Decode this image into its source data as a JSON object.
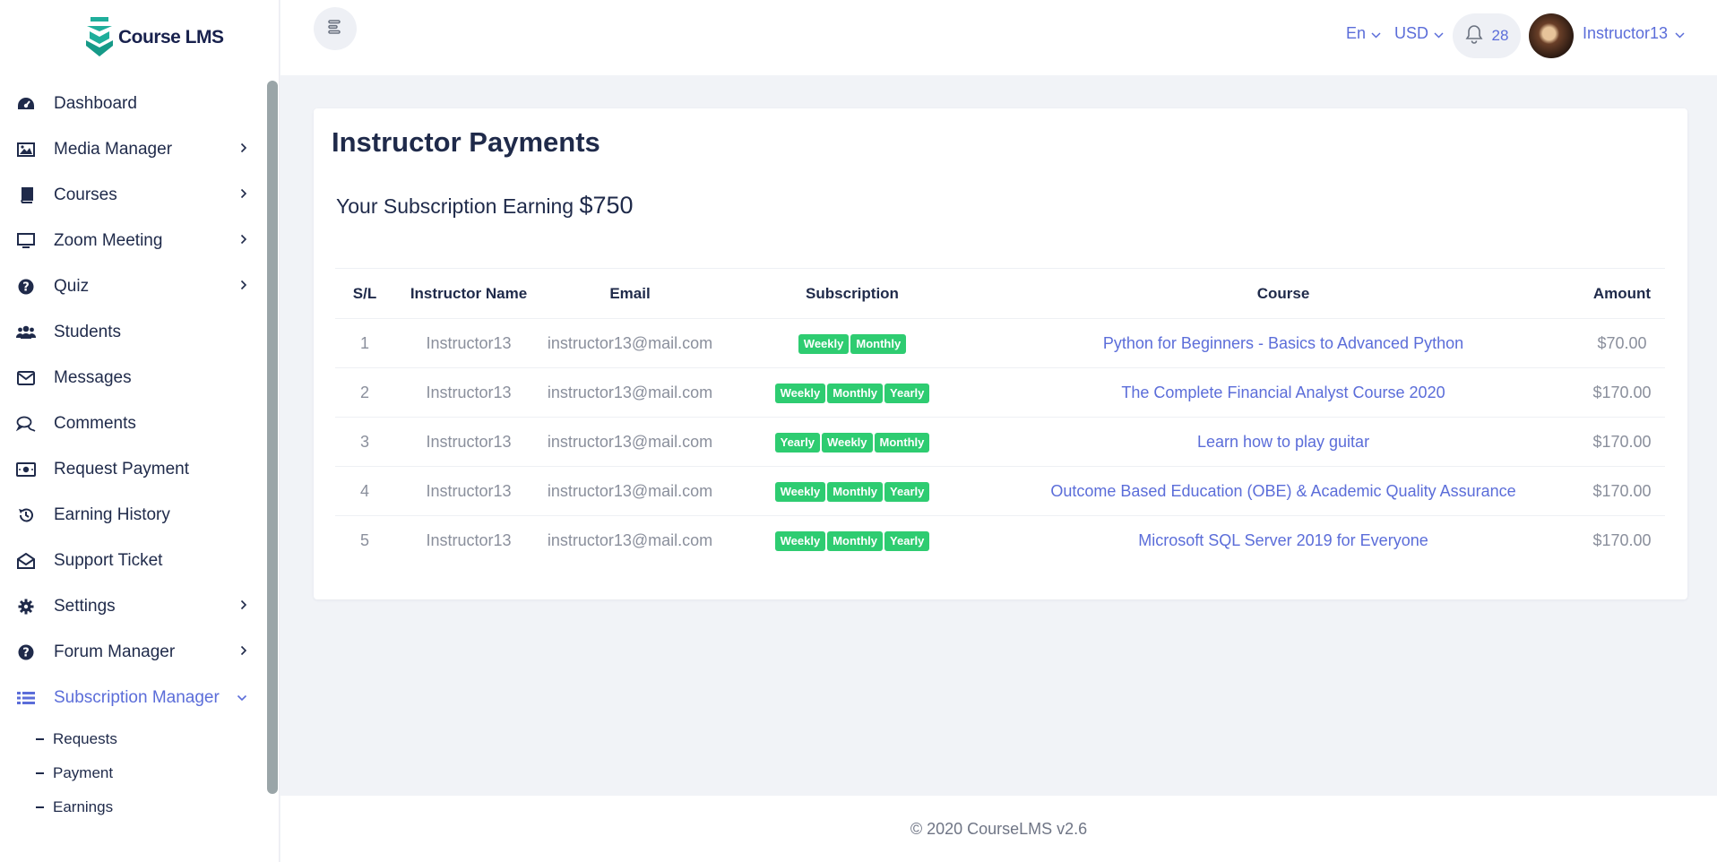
{
  "brand": {
    "name": "Course LMS"
  },
  "sidebar": {
    "items": [
      {
        "label": "Dashboard",
        "icon": "dashboard-icon",
        "has_children": false
      },
      {
        "label": "Media Manager",
        "icon": "image-icon",
        "has_children": true
      },
      {
        "label": "Courses",
        "icon": "book-icon",
        "has_children": true
      },
      {
        "label": "Zoom Meeting",
        "icon": "monitor-icon",
        "has_children": true
      },
      {
        "label": "Quiz",
        "icon": "question-icon",
        "has_children": true
      },
      {
        "label": "Students",
        "icon": "users-icon",
        "has_children": false
      },
      {
        "label": "Messages",
        "icon": "envelope-icon",
        "has_children": false
      },
      {
        "label": "Comments",
        "icon": "comments-icon",
        "has_children": false
      },
      {
        "label": "Request Payment",
        "icon": "money-icon",
        "has_children": false
      },
      {
        "label": "Earning History",
        "icon": "history-icon",
        "has_children": false
      },
      {
        "label": "Support Ticket",
        "icon": "envelope-open-icon",
        "has_children": false
      },
      {
        "label": "Settings",
        "icon": "gear-icon",
        "has_children": true
      },
      {
        "label": "Forum Manager",
        "icon": "question-icon",
        "has_children": true
      },
      {
        "label": "Subscription Manager",
        "icon": "list-icon",
        "has_children": true,
        "active": true
      }
    ],
    "subitems": [
      "Requests",
      "Payment",
      "Earnings"
    ]
  },
  "topbar": {
    "language": "En",
    "currency": "USD",
    "notification_count": "28",
    "user_name": "Instructor13"
  },
  "page": {
    "title": "Instructor Payments",
    "earning_label": "Your Subscription Earning",
    "earning_amount": "$750"
  },
  "table": {
    "headers": [
      "S/L",
      "Instructor Name",
      "Email",
      "Subscription",
      "Course",
      "Amount"
    ],
    "rows": [
      {
        "sl": "1",
        "name": "Instructor13",
        "email": "instructor13@mail.com",
        "subscriptions": [
          "Weekly",
          "Monthly"
        ],
        "course": "Python for Beginners - Basics to Advanced Python",
        "amount": "$70.00"
      },
      {
        "sl": "2",
        "name": "Instructor13",
        "email": "instructor13@mail.com",
        "subscriptions": [
          "Weekly",
          "Monthly",
          "Yearly"
        ],
        "course": "The Complete Financial Analyst Course 2020",
        "amount": "$170.00"
      },
      {
        "sl": "3",
        "name": "Instructor13",
        "email": "instructor13@mail.com",
        "subscriptions": [
          "Yearly",
          "Weekly",
          "Monthly"
        ],
        "course": "Learn how to play guitar",
        "amount": "$170.00"
      },
      {
        "sl": "4",
        "name": "Instructor13",
        "email": "instructor13@mail.com",
        "subscriptions": [
          "Weekly",
          "Monthly",
          "Yearly"
        ],
        "course": "Outcome Based Education (OBE) & Academic Quality Assurance",
        "amount": "$170.00"
      },
      {
        "sl": "5",
        "name": "Instructor13",
        "email": "instructor13@mail.com",
        "subscriptions": [
          "Weekly",
          "Monthly",
          "Yearly"
        ],
        "course": "Microsoft SQL Server 2019 for Everyone",
        "amount": "$170.00"
      }
    ]
  },
  "footer": {
    "text": "© 2020 CourseLMS v2.6"
  },
  "colors": {
    "accent": "#5b6dd9",
    "badge": "#2ecc71",
    "text": "#1f2a4a",
    "muted": "#8a8f9c",
    "background": "#f1f3f7"
  }
}
